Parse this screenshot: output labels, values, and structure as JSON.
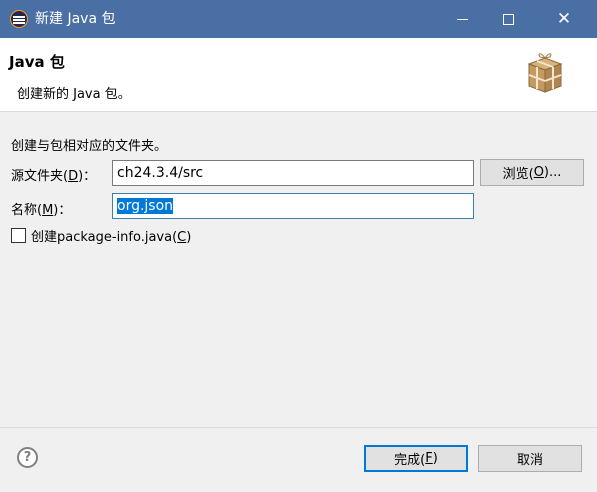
{
  "window": {
    "title": "新建 Java 包"
  },
  "header": {
    "title": "Java 包",
    "description": "创建新的 Java 包。"
  },
  "form": {
    "group_label": "创建与包相对应的文件夹。",
    "source_folder": {
      "label_pre": "源文件夹(",
      "mnemonic": "D",
      "label_post": ")：",
      "value": "ch24.3.4/src"
    },
    "browse": {
      "pre": "浏览(",
      "mnemonic": "O",
      "post": ")..."
    },
    "name": {
      "label_pre": "名称(",
      "mnemonic": "M",
      "label_post": ")：",
      "value": "org.json"
    },
    "create_package_info": {
      "pre": "创建package-info.java(",
      "mnemonic": "C",
      "post": ")",
      "checked": false
    }
  },
  "footer": {
    "help_symbol": "?",
    "finish": {
      "pre": "完成(",
      "mnemonic": "F",
      "post": ")"
    },
    "cancel": "取消"
  },
  "icons": {
    "app": "eclipse-icon",
    "header": "package-icon",
    "help": "help-icon"
  },
  "colors": {
    "titlebar": "#4a6fa5",
    "selection": "#0078d7",
    "default_button_border": "#0078d7"
  }
}
